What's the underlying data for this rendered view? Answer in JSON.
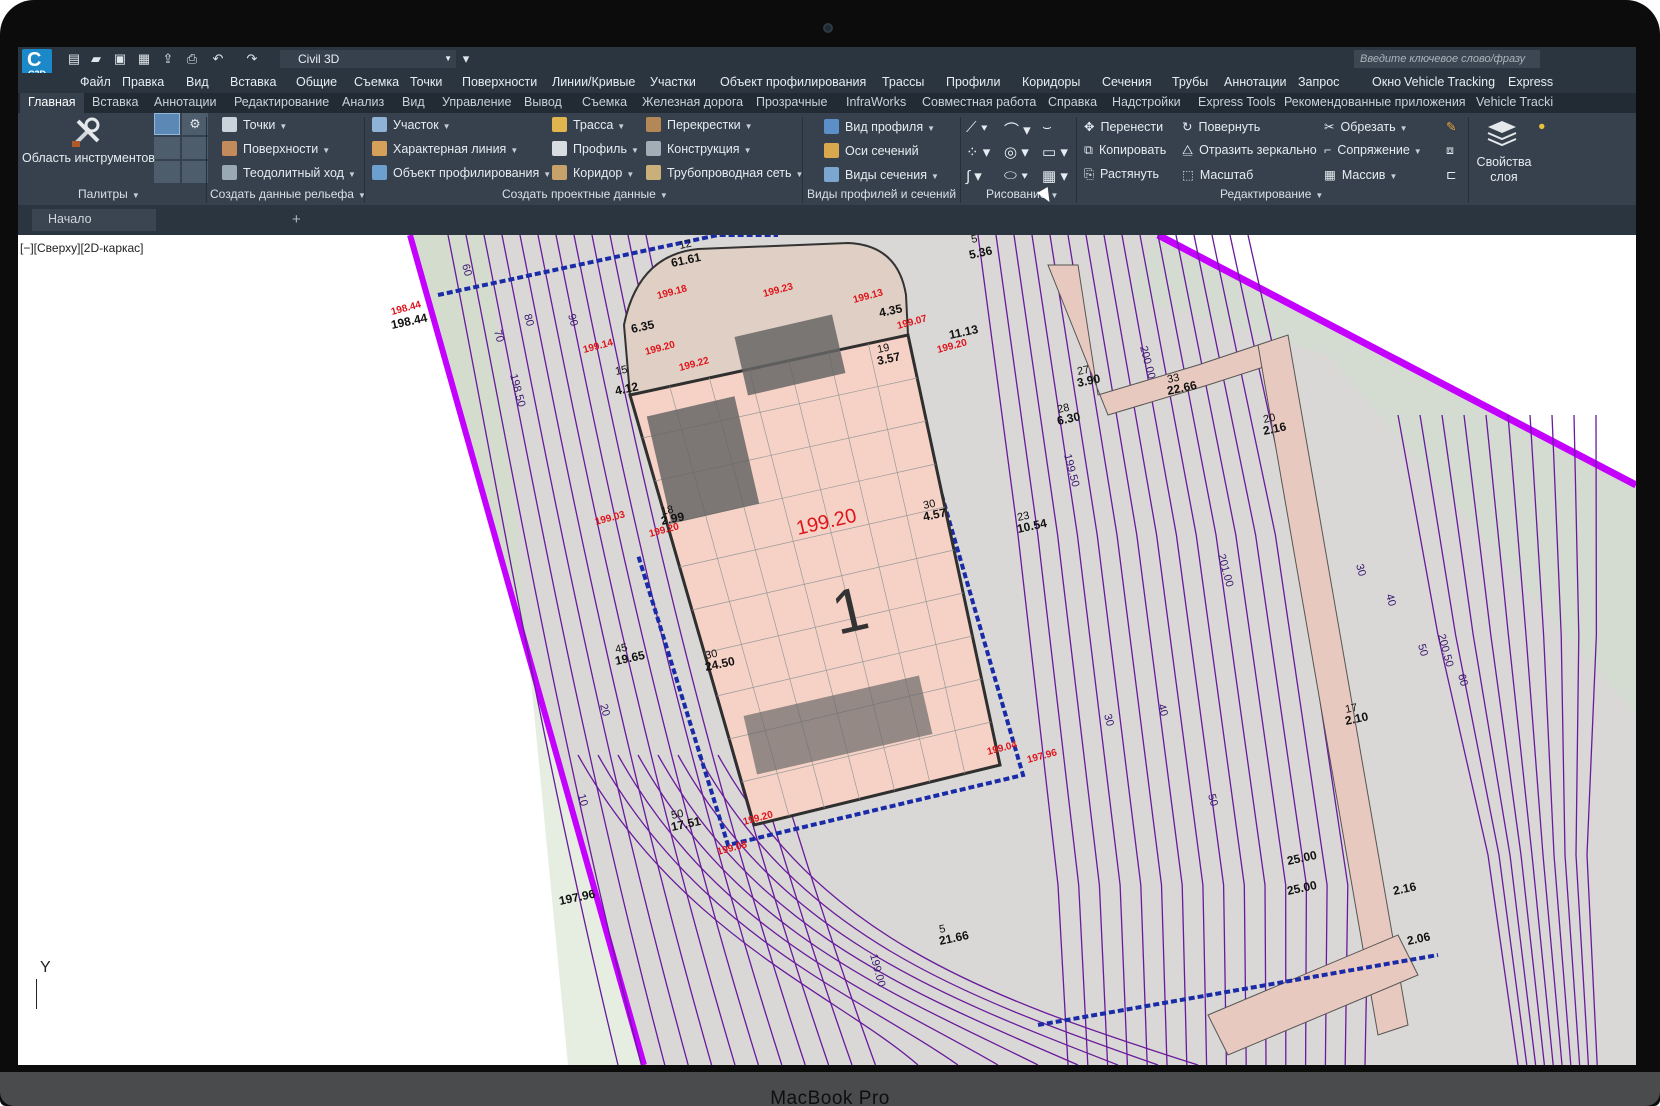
{
  "device": {
    "label": "MacBook Pro"
  },
  "app": {
    "logo_text": "C3D",
    "workspace": "Civil 3D",
    "search_placeholder": "Введите ключевое слово/фразу"
  },
  "menu": [
    "Файл",
    "Правка",
    "Вид",
    "Вставка",
    "Общие",
    "Съемка",
    "Точки",
    "Поверхности",
    "Линии/Кривые",
    "Участки",
    "Объект профилирования",
    "Трассы",
    "Профили",
    "Коридоры",
    "Сечения",
    "Трубы",
    "Аннотации",
    "Запрос",
    "Окно",
    "Vehicle Tracking",
    "Express"
  ],
  "tabs": [
    "Главная",
    "Вставка",
    "Аннотации",
    "Редактирование",
    "Анализ",
    "Вид",
    "Управление",
    "Вывод",
    "Съемка",
    "Железная дорога",
    "Прозрачные",
    "InfraWorks",
    "Совместная работа",
    "Справка",
    "Надстройки",
    "Express Tools",
    "Рекомендованные приложения",
    "Vehicle Tracki"
  ],
  "ribbon": {
    "palettes": {
      "tool_area": "Область инструментов",
      "title": "Палитры"
    },
    "terrain": {
      "points": "Точки",
      "surfaces": "Поверхности",
      "traverse": "Теодолитный ход",
      "title": "Создать данные рельефа"
    },
    "design": {
      "parcel": "Участок",
      "feature_line": "Характерная линия",
      "grading": "Объект профилирования",
      "alignment": "Трасса",
      "profile": "Профиль",
      "corridor": "Коридор",
      "intersections": "Перекрестки",
      "assembly": "Конструкция",
      "pipe_network": "Трубопроводная сеть",
      "title": "Создать проектные данные"
    },
    "views": {
      "profile_view": "Вид профиля",
      "sample_lines": "Оси сечений",
      "section_views": "Виды сечения",
      "title": "Виды профилей и сечений"
    },
    "draw": {
      "title": "Рисование"
    },
    "modify": {
      "move": "Перенести",
      "copy": "Копировать",
      "stretch": "Растянуть",
      "rotate": "Повернуть",
      "mirror": "Отразить зеркально",
      "scale": "Масштаб",
      "trim": "Обрезать",
      "fillet": "Сопряжение",
      "array": "Массив",
      "title": "Редактирование"
    },
    "layers": {
      "props": "Свойства слоя"
    }
  },
  "file_tab": {
    "name": "Начало",
    "plus": "+"
  },
  "viewport": {
    "label": "[−][Сверху][2D-каркас]",
    "ucs_y": "Y"
  },
  "drawing": {
    "building_level": "199.20",
    "building_number": "1",
    "red_marks": [
      "198.44",
      "199.14",
      "199.20",
      "199.22",
      "199.18",
      "199.23",
      "199.13",
      "199.07",
      "199.20",
      "199.03",
      "199.20",
      "199.20",
      "199.08",
      "199.04",
      "197.96"
    ],
    "black_marks": [
      "198.44",
      "61.61",
      "5.36",
      "4.35",
      "4.12",
      "3.57",
      "11.13",
      "6.35",
      "2.99",
      "4.57",
      "10.54",
      "19.65",
      "24.50",
      "17.51",
      "197.96",
      "21.66",
      "6.30",
      "22.66",
      "3.90",
      "2.16",
      "2.10",
      "25.00",
      "25.00",
      "2.16",
      "2.06"
    ],
    "contour_labels": [
      "60",
      "70",
      "80",
      "90",
      "198.50",
      "199.50",
      "200.00",
      "201.00",
      "200.50",
      "199.00",
      "10",
      "20",
      "30",
      "40",
      "50",
      "30",
      "40",
      "50",
      "60"
    ],
    "grade_labels": [
      "12",
      "5",
      "15",
      "18",
      "19",
      "30",
      "23",
      "45",
      "30",
      "50",
      "5",
      "28",
      "33",
      "27",
      "20",
      "17"
    ]
  },
  "colors": {
    "title_bg": "#2b3540",
    "ribbon_bg": "#36414d",
    "magenta": "#c400ff",
    "purple_line": "#6a1a9c",
    "building_fill": "#f6d2c6",
    "blue_edge": "#1a2ba8",
    "red_text": "#e0141b"
  }
}
